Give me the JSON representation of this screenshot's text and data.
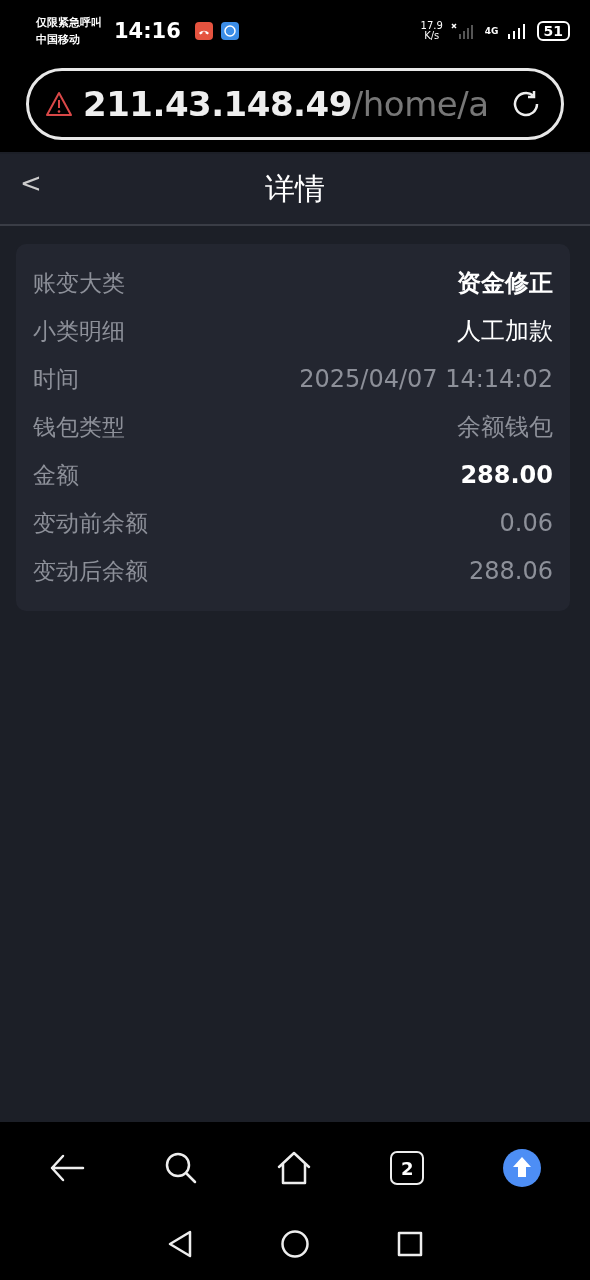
{
  "status_bar": {
    "carrier_lines": [
      "仅限紧急呼叫",
      "中国移动"
    ],
    "time": "14:16",
    "speed_value": "17.9",
    "speed_unit": "K/s",
    "network": "4G",
    "battery": "51"
  },
  "address_bar": {
    "host": "211.43.148.49",
    "path": "/home/a"
  },
  "header": {
    "back": "<",
    "title": "详情"
  },
  "details": [
    {
      "label": "账变大类",
      "value": "资金修正",
      "kind": "bold"
    },
    {
      "label": "小类明细",
      "value": "人工加款",
      "kind": "bright"
    },
    {
      "label": "时间",
      "value": "2025/04/07 14:14:02",
      "kind": "muted"
    },
    {
      "label": "钱包类型",
      "value": "余额钱包",
      "kind": "muted"
    },
    {
      "label": "金额",
      "value": "288.00",
      "kind": "bold"
    },
    {
      "label": "变动前余额",
      "value": "0.06",
      "kind": "muted"
    },
    {
      "label": "变动后余额",
      "value": "288.06",
      "kind": "muted"
    }
  ],
  "browser_toolbar": {
    "tab_count": "2"
  }
}
